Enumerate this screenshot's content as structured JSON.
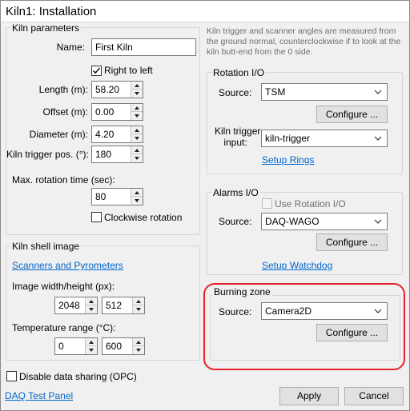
{
  "window": {
    "title": "Kiln1: Installation"
  },
  "kiln_parameters": {
    "group_label": "Kiln parameters",
    "name_label": "Name:",
    "name_value": "First Kiln",
    "right_to_left_label": "Right to left",
    "right_to_left_checked": true,
    "length_label": "Length (m):",
    "length_value": "58.20",
    "offset_label": "Offset (m):",
    "offset_value": "0.00",
    "diameter_label": "Diameter (m):",
    "diameter_value": "4.20",
    "trigger_pos_label": "Kiln trigger pos. (°):",
    "trigger_pos_value": "180",
    "max_rotation_label": "Max. rotation time (sec):",
    "max_rotation_value": "80",
    "clockwise_label": "Clockwise rotation",
    "clockwise_checked": false
  },
  "kiln_shell_image": {
    "group_label": "Kiln shell image",
    "scanners_link": "Scanners and Pyrometers",
    "image_size_label": "Image width/height (px):",
    "width_value": "2048",
    "height_value": "512",
    "temp_range_label": "Temperature range (°C):",
    "temp_min_value": "0",
    "temp_max_value": "600"
  },
  "disable_sharing": {
    "label": "Disable data sharing (OPC)",
    "checked": false
  },
  "daq_test_panel_link": "DAQ Test Panel",
  "info_text": "Kiln trigger and scanner angles are measured from the ground normal, counterclockwise if to look at the kiln butt-end from the 0 side.",
  "rotation_io": {
    "group_label": "Rotation I/O",
    "source_label": "Source:",
    "source_value": "TSM",
    "configure_label": "Configure ...",
    "trigger_input_label_line1": "Kiln trigger",
    "trigger_input_label_line2": "input:",
    "trigger_input_value": "kiln-trigger",
    "setup_rings_link": "Setup Rings"
  },
  "alarms_io": {
    "group_label": "Alarms I/O",
    "use_rotation_label": "Use Rotation I/O",
    "use_rotation_checked": false,
    "source_label": "Source:",
    "source_value": "DAQ-WAGO",
    "configure_label": "Configure ...",
    "setup_watchdog_link": "Setup Watchdog"
  },
  "burning_zone": {
    "group_label": "Burning zone",
    "source_label": "Source:",
    "source_value": "Camera2D",
    "configure_label": "Configure ..."
  },
  "buttons": {
    "apply_label": "Apply",
    "cancel_label": "Cancel"
  },
  "colors": {
    "highlight": "#e8202a",
    "link": "#0066cc"
  }
}
